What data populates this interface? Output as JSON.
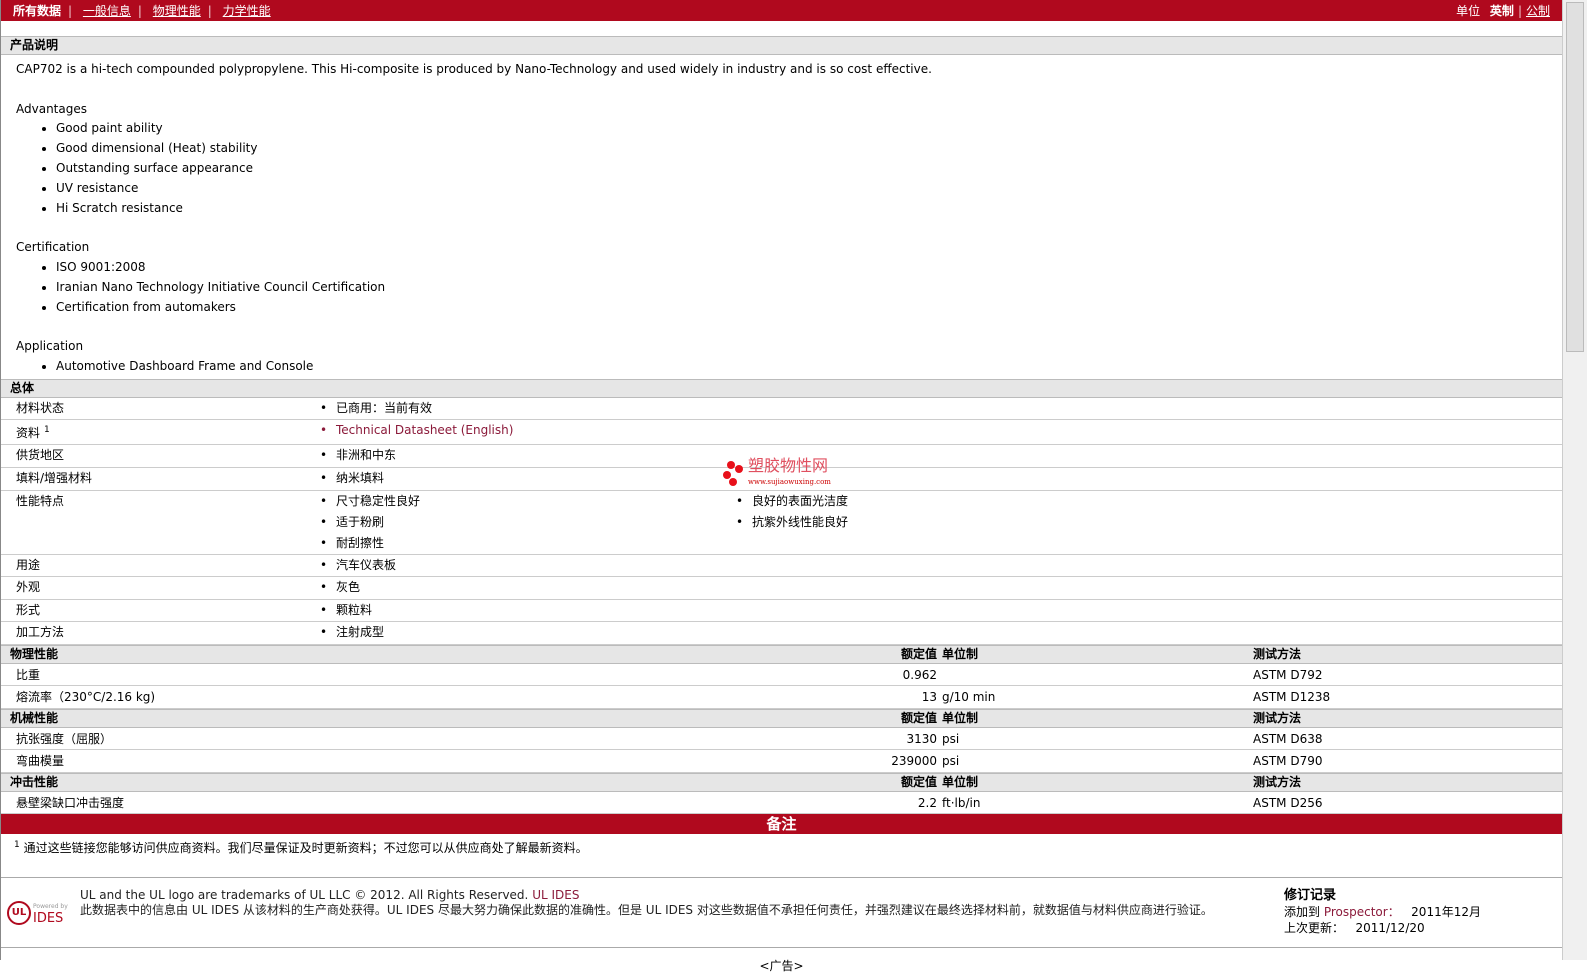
{
  "topbar": {
    "tabs": [
      "所有数据",
      "一般信息",
      "物理性能",
      "力学性能"
    ],
    "units_label": "单位",
    "unit_active": "英制",
    "unit_other": "公制"
  },
  "description": {
    "title": "产品说明",
    "intro": "CAP702 is a hi-tech compounded polypropylene. This Hi-composite is produced by Nano-Technology and used widely in industry and is so cost effective.",
    "groups": [
      {
        "heading": "Advantages",
        "items": [
          "Good paint ability",
          "Good dimensional (Heat) stability",
          "Outstanding surface appearance",
          "UV resistance",
          "Hi Scratch resistance"
        ]
      },
      {
        "heading": "Certification",
        "items": [
          "ISO 9001:2008",
          "Iranian Nano Technology Initiative Council Certification",
          "Certification from automakers"
        ]
      },
      {
        "heading": "Application",
        "items": [
          "Automotive Dashboard Frame and Console"
        ]
      }
    ]
  },
  "general": {
    "title": "总体",
    "rows": [
      {
        "key": "材料状态",
        "values": [
          "已商用：当前有效"
        ]
      },
      {
        "key": "资料",
        "sup": "1",
        "values": [
          "Technical Datasheet (English)"
        ],
        "link": true
      },
      {
        "key": "供货地区",
        "values": [
          "非洲和中东"
        ]
      },
      {
        "key": "填料/增强材料",
        "values": [
          "纳米填料"
        ]
      },
      {
        "key": "性能特点",
        "values": [
          "尺寸稳定性良好",
          "良好的表面光洁度",
          "适于粉刷",
          "抗紫外线性能良好",
          "耐刮擦性"
        ]
      },
      {
        "key": "用途",
        "values": [
          "汽车仪表板"
        ]
      },
      {
        "key": "外观",
        "values": [
          "灰色"
        ]
      },
      {
        "key": "形式",
        "values": [
          "颗粒料"
        ]
      },
      {
        "key": "加工方法",
        "values": [
          "注射成型"
        ]
      }
    ]
  },
  "col_headers": {
    "value": "额定值",
    "unit": "单位制",
    "method": "测试方法"
  },
  "property_sections": [
    {
      "title": "物理性能",
      "rows": [
        {
          "name": "比重",
          "value": "0.962",
          "unit": "",
          "method": "ASTM D792"
        },
        {
          "name": "熔流率（230°C/2.16 kg)",
          "value": "13",
          "unit": "g/10 min",
          "method": "ASTM D1238"
        }
      ]
    },
    {
      "title": "机械性能",
      "rows": [
        {
          "name": "抗张强度（屈服）",
          "value": "3130",
          "unit": "psi",
          "method": "ASTM D638"
        },
        {
          "name": "弯曲模量",
          "value": "239000",
          "unit": "psi",
          "method": "ASTM D790"
        }
      ]
    },
    {
      "title": "冲击性能",
      "rows": [
        {
          "name": "悬壁梁缺口冲击强度",
          "value": "2.2",
          "unit": "ft·lb/in",
          "method": "ASTM D256"
        }
      ]
    }
  ],
  "notes": {
    "title": "备注",
    "footnote_num": "1",
    "footnote": "通过这些链接您能够访问供应商资料。我们尽量保证及时更新资料；不过您可以从供应商处了解最新资料。"
  },
  "footer": {
    "logo_text": "UL",
    "logo_sub": "IDES",
    "powered": "Powered by",
    "trademark": "UL and the UL logo are trademarks of UL LLC © 2012. All Rights Reserved.",
    "ul_ides": "UL IDES",
    "disclaimer": "此数据表中的信息由 UL IDES 从该材料的生产商处获得。UL IDES 尽最大努力确保此数据的准确性。但是 UL IDES 对这些数据值不承担任何责任，并强烈建议在最终选择材料前，就数据值与材料供应商进行验证。",
    "rev_title": "修订记录",
    "added_label": "添加到",
    "prospector": "Prospector：",
    "added_date": "2011年12月",
    "updated_label": "上次更新：",
    "updated_date": "2011/12/20",
    "ad": "<广告>"
  },
  "watermark": {
    "name": "塑胶物性网",
    "url": "www.sujiaowuxing.com"
  }
}
